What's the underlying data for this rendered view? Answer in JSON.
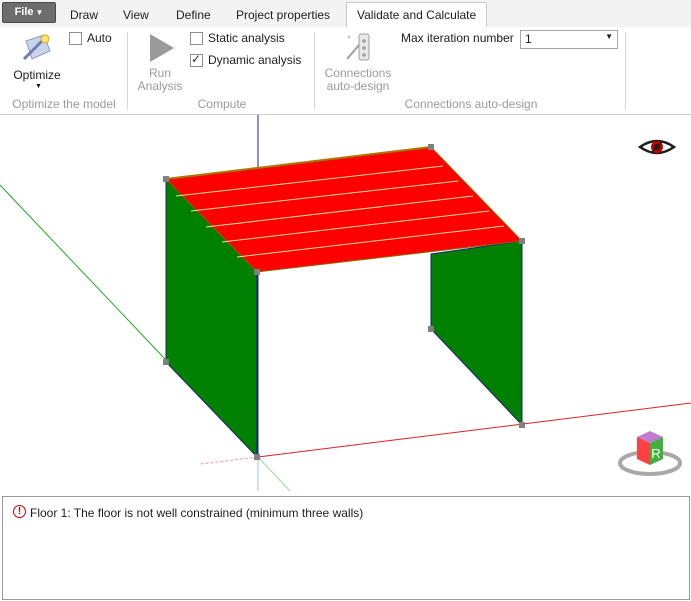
{
  "menu": {
    "file_label": "File",
    "tabs": [
      "Draw",
      "View",
      "Define",
      "Project properties",
      "Validate and Calculate"
    ],
    "active_tab": "Validate and Calculate"
  },
  "ribbon": {
    "optimize": {
      "button_label": "Optimize",
      "auto_label": "Auto",
      "auto_checked": false,
      "group_label": "Optimize the model"
    },
    "compute": {
      "run_line1": "Run",
      "run_line2": "Analysis",
      "static_label": "Static analysis",
      "static_checked": false,
      "dynamic_label": "Dynamic analysis",
      "dynamic_checked": true,
      "group_label": "Compute"
    },
    "connections": {
      "btn_line1": "Connections",
      "btn_line2": "auto-design",
      "max_iter_label": "Max iteration number",
      "max_iter_value": "1",
      "group_label": "Connections auto-design"
    }
  },
  "viewport": {
    "cube_letter": "R",
    "floor_color": "#ff0000",
    "wall_color": "#008000"
  },
  "messages": [
    {
      "type": "error",
      "text": "Floor 1: The floor is not well constrained (minimum three walls)"
    }
  ]
}
